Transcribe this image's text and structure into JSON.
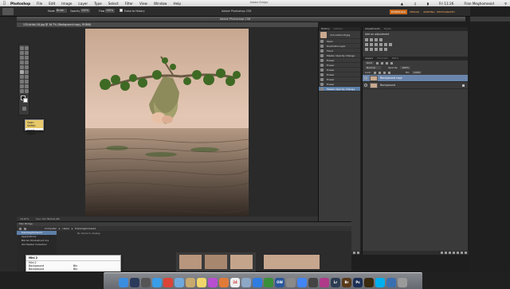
{
  "menubar": {
    "apple": "",
    "app": "Photoshop",
    "items": [
      "File",
      "Edit",
      "Image",
      "Layer",
      "Type",
      "Select",
      "Filter",
      "View",
      "Window",
      "Help"
    ],
    "clock": "Fri 11:26",
    "user": "Fran Meghomeoid"
  },
  "app_title": "Adobe Photoshop CS6",
  "bridge_title": "Adobe Bridge",
  "workspace": {
    "buttons": [
      "ESSENTIALS",
      "DESIGN",
      "PAINTING",
      "PHOTOGRAPHY",
      "ESSENTIALS"
    ],
    "active_index": 0
  },
  "options_bar": {
    "mode_label": "Mode",
    "mode_value": "Brush",
    "opacity_label": "Opacity",
    "opacity_value": "100%",
    "flow_label": "Flow",
    "flow_value": "100%",
    "erase_history": "Erase to History"
  },
  "document": {
    "tab": "115-Artist-18.jpg @ 16.7% (Background copy, RGB/8)",
    "status_zoom": "16.67%",
    "status_doc": "Doc: 63.7M/119.4M"
  },
  "history": {
    "tabs": [
      "History",
      "Actions"
    ],
    "snapshot": "115-Artist-18.jpg",
    "items": [
      "Open",
      "Duplicate Layer",
      "Flood",
      "Master Opacity Change",
      "Eraser",
      "Eraser",
      "Eraser",
      "Eraser",
      "Eraser",
      "Eraser",
      "Master Opacity Change"
    ],
    "selected_index": 10
  },
  "adjustments": {
    "tabs": [
      "Adjustments",
      "Styles"
    ],
    "add_label": "Add an adjustment"
  },
  "layers": {
    "tabs": [
      "Layers",
      "Channels",
      "Paths"
    ],
    "kind_label": "Kind",
    "blend": "Normal",
    "opacity_label": "Opacity:",
    "opacity_value": "100%",
    "lock_label": "Lock:",
    "fill_label": "Fill:",
    "fill_value": "100%",
    "items": [
      {
        "name": "Background copy",
        "selected": true
      },
      {
        "name": "Background",
        "selected": false
      }
    ]
  },
  "context_popup": {
    "items": [
      "Open Selfish",
      "Insert Object"
    ]
  },
  "bridge": {
    "tabs": [
      "Mini Bridge"
    ],
    "path": [
      "Computer",
      "Users",
      "franmeghomeoid"
    ],
    "sidebar_header": "franmeghomeoid",
    "items": [
      "Applications",
      "Bitcoin Photoshoot Cra",
      "Old Master Collection"
    ],
    "empty_msg": "No items to display"
  },
  "bottom_popup": {
    "title": "Mini 2",
    "rows": [
      {
        "name": "Mini 2",
        "val": ""
      },
      {
        "name": "Background",
        "val": "Bkr"
      },
      {
        "name": "Background",
        "val": "Bkr"
      }
    ]
  },
  "dock": {
    "icons": [
      {
        "name": "finder-icon",
        "label": "",
        "color": "#3b8de0"
      },
      {
        "name": "dashboard-icon",
        "label": "",
        "color": "#2a3a5a"
      },
      {
        "name": "mission-control-icon",
        "label": "",
        "color": "#555"
      },
      {
        "name": "safari-icon",
        "label": "",
        "color": "#3a9de8"
      },
      {
        "name": "chrome-icon",
        "label": "",
        "color": "#dc4437"
      },
      {
        "name": "mail-icon",
        "label": "",
        "color": "#6fa8dc"
      },
      {
        "name": "folder-icon",
        "label": "",
        "color": "#c8a96e"
      },
      {
        "name": "notes-icon",
        "label": "",
        "color": "#f1d66b"
      },
      {
        "name": "itunes-icon",
        "label": "",
        "color": "#b84fd0"
      },
      {
        "name": "photos-icon",
        "label": "",
        "color": "#e07b39"
      },
      {
        "name": "calendar-icon",
        "label": "24",
        "color": "#eeeeee"
      },
      {
        "name": "preview-icon",
        "label": "",
        "color": "#8da7c6"
      },
      {
        "name": "app-store-icon",
        "label": "",
        "color": "#2f7de1"
      },
      {
        "name": "facetime-icon",
        "label": "",
        "color": "#3a8f3a"
      },
      {
        "name": "word-icon",
        "label": "OW",
        "color": "#2b579a"
      },
      {
        "name": "system-prefs-icon",
        "label": "",
        "color": "#8a8a8a"
      },
      {
        "name": "chrome2-icon",
        "label": "",
        "color": "#4285f4"
      },
      {
        "name": "camera-icon",
        "label": "",
        "color": "#444"
      },
      {
        "name": "music-icon",
        "label": "",
        "color": "#b03a8a"
      },
      {
        "name": "lightroom-icon",
        "label": "Lr",
        "color": "#2e3c52"
      },
      {
        "name": "bridge-icon",
        "label": "Br",
        "color": "#5a3a1a"
      },
      {
        "name": "photoshop-icon",
        "label": "Ps",
        "color": "#1c2f55"
      },
      {
        "name": "illustrator-icon",
        "label": "",
        "color": "#3a2a10"
      },
      {
        "name": "skype-icon",
        "label": "",
        "color": "#00aff0"
      },
      {
        "name": "globe-icon",
        "label": "",
        "color": "#3a6fb0"
      },
      {
        "name": "trash-icon",
        "label": "",
        "color": "#9a9a9a"
      }
    ]
  }
}
